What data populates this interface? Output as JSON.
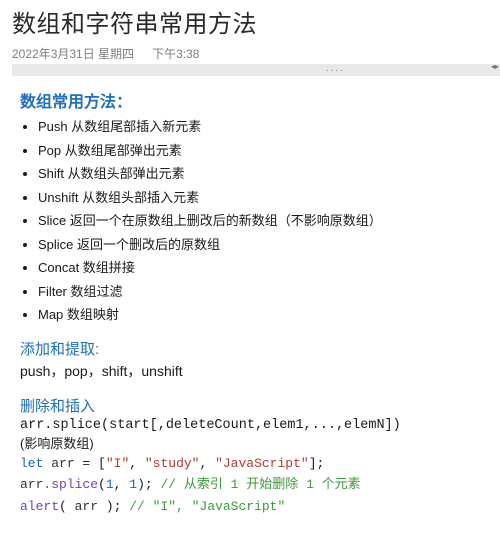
{
  "title": "数组和字符串常用方法",
  "meta": {
    "date": "2022年3月31日 星期四",
    "time": "下午3:38"
  },
  "sections": {
    "array_methods": {
      "heading": "数组常用方法：",
      "items": [
        "Push 从数组尾部插入新元素",
        "Pop 从数组尾部弹出元素",
        "Shift 从数组头部弹出元素",
        "Unshift 从数组头部插入元素",
        "Slice 返回一个在原数组上删改后的新数组（不影响原数组）",
        "Splice 返回一个删改后的原数组",
        "Concat 数组拼接",
        "Filter 数组过滤",
        "Map 数组映射"
      ]
    },
    "add_extract": {
      "heading": "添加和提取:",
      "body": "push，pop，shift，unshift"
    },
    "del_insert": {
      "heading": "删除和插入",
      "signature": "arr.splice(start[,deleteCount,elem1,...,elemN])",
      "note": "(影响原数组)",
      "code": {
        "kw_let": "let",
        "id_arr": "arr",
        "eq": " = [",
        "s1": "\"I\"",
        "s2": "\"study\"",
        "s3": "\"JavaScript\"",
        "close1": "];",
        "line2_obj": "arr",
        "line2_fn": ".splice",
        "line2_args_open": "(",
        "line2_n1": "1",
        "line2_comma": ", ",
        "line2_n2": "1",
        "line2_args_close": "); ",
        "line2_cm": "// 从索引 1 开始删除 1 个元素",
        "line3_fn": "alert",
        "line3_open": "( ",
        "line3_arg": "arr",
        "line3_close": " ); ",
        "line3_cm": "// \"I\", \"JavaScript\""
      }
    }
  }
}
